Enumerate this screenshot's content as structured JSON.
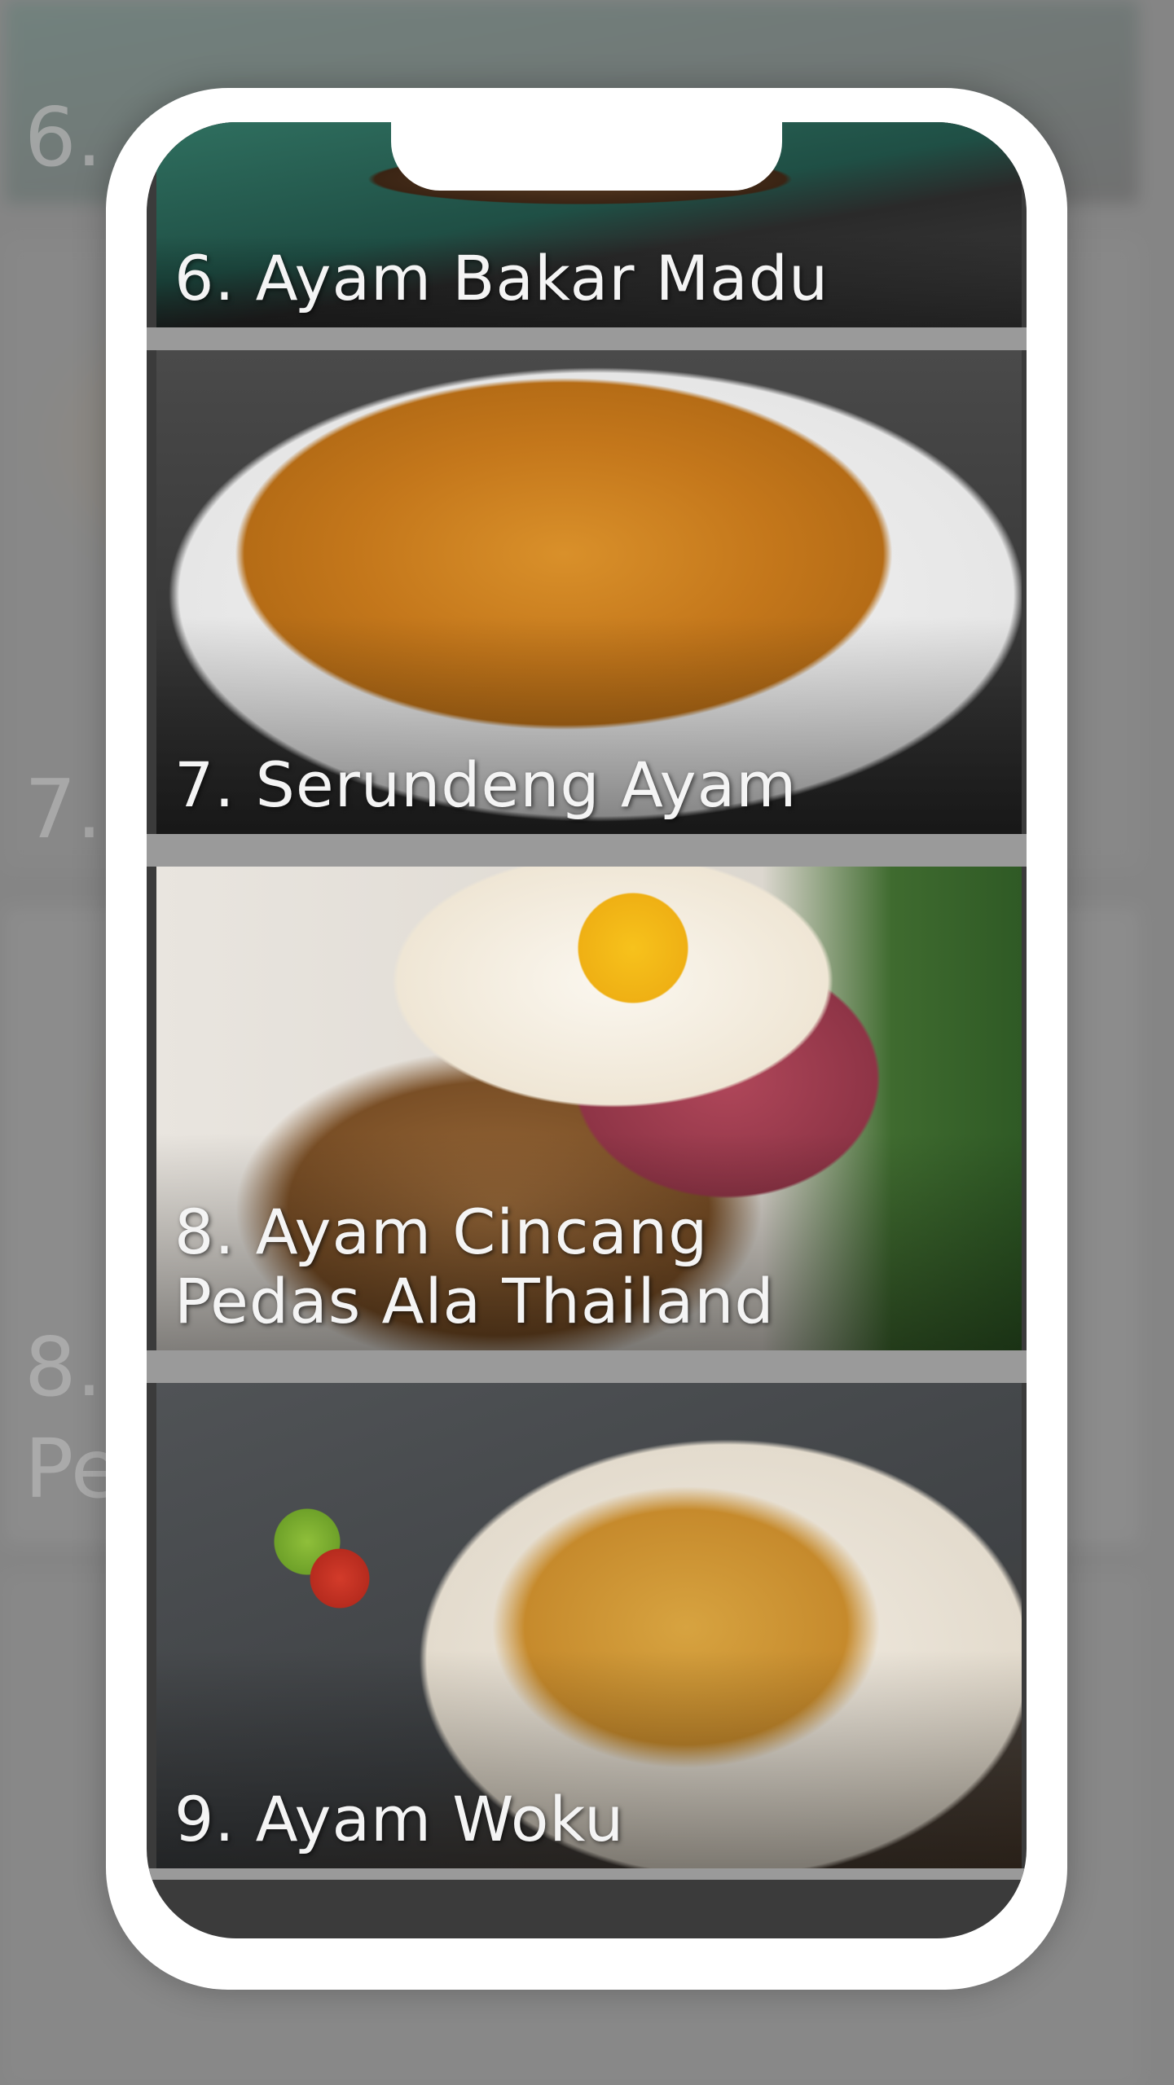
{
  "recipes": [
    {
      "title": "6. Ayam Bakar Madu"
    },
    {
      "title": "7. Serundeng Ayam"
    },
    {
      "title": "8. Ayam Cincang Pedas Ala Thailand"
    },
    {
      "title": "9. Ayam Woku"
    }
  ],
  "background_labels": {
    "item6": "6.",
    "item7": "7.",
    "item8_line1": "8.",
    "item8_line2": "Pe"
  },
  "colors": {
    "phone_frame": "#ffffff",
    "screen_background": "#3b3b3b",
    "title_text": "#f4f4f4"
  }
}
